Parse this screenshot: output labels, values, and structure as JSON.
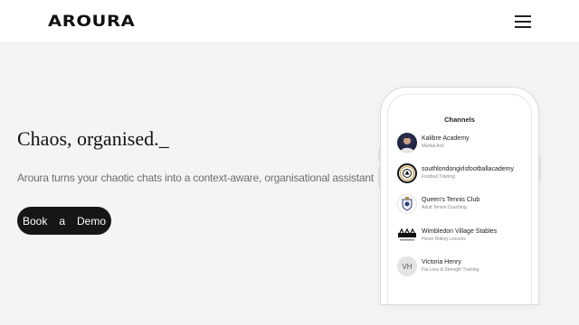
{
  "header": {
    "logo_text": "AROURA",
    "menu_icon": "hamburger-icon"
  },
  "hero": {
    "headline": "Chaos, organised._",
    "subline": "Aroura turns your chaotic chats into a context-aware, organisational assistant",
    "cta": {
      "word1": "Book",
      "word2": "a",
      "word3": "Demo"
    }
  },
  "phone": {
    "title": "Channels",
    "channels": [
      {
        "name": "Kalibre Academy",
        "subtitle": "Martial Arts",
        "avatar": "person-photo-avatar"
      },
      {
        "name": "southlondongirlsfootballacademy",
        "subtitle": "Football Training",
        "avatar": "football-crest-avatar"
      },
      {
        "name": "Queen's Tennis Club",
        "subtitle": "Adult Tennis Coaching",
        "avatar": "tennis-crest-avatar"
      },
      {
        "name": "Wimbledon Village Stables",
        "subtitle": "Horse Riding Lessons",
        "avatar": "stables-logo-avatar"
      },
      {
        "name": "Victoria Henry",
        "subtitle": "Fat Loss & Strength Training",
        "avatar_initials": "VH"
      }
    ]
  },
  "colors": {
    "background": "#f4f4f4",
    "header_bg": "#ffffff",
    "cta_bg": "#161616",
    "text_primary": "#111111",
    "text_muted": "#6e6e6e"
  }
}
